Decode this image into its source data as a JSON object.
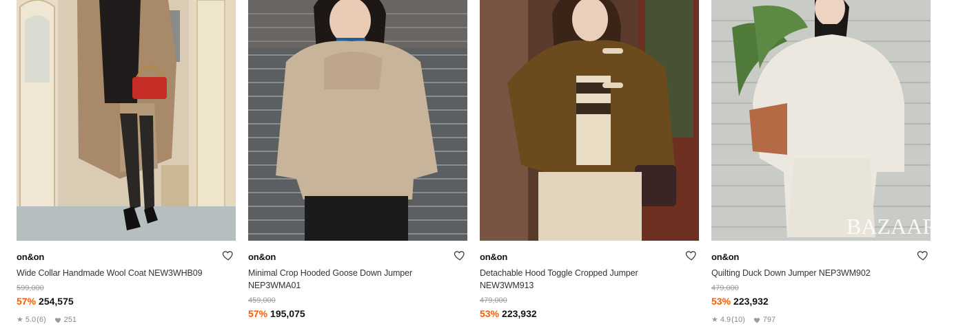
{
  "products": [
    {
      "brand": "on&on",
      "name": "Wide Collar Handmade Wool Coat NEW3WHB09",
      "original_price": "599,000",
      "discount": "57%",
      "sale_price": "254,575",
      "rating": "5.0",
      "reviews": "(6)",
      "likes": "251"
    },
    {
      "brand": "on&on",
      "name": "Minimal Crop Hooded Goose Down Jumper NEP3WMA01",
      "original_price": "459,000",
      "discount": "57%",
      "sale_price": "195,075"
    },
    {
      "brand": "on&on",
      "name": "Detachable Hood Toggle Cropped Jumper NEW3WM913",
      "original_price": "479,000",
      "discount": "53%",
      "sale_price": "223,932"
    },
    {
      "brand": "on&on",
      "name": "Quilting Duck Down Jumper NEP3WM902",
      "original_price": "479,000",
      "discount": "53%",
      "sale_price": "223,932",
      "rating": "4.9",
      "reviews": "(10)",
      "likes": "797",
      "watermark": "BAZAAR"
    }
  ],
  "icons": {
    "wishlist": "heart-outline-icon",
    "rating": "star-icon",
    "likes": "heart-filled-icon"
  },
  "colors": {
    "discount": "#ff5a00",
    "original_price": "#999999"
  }
}
